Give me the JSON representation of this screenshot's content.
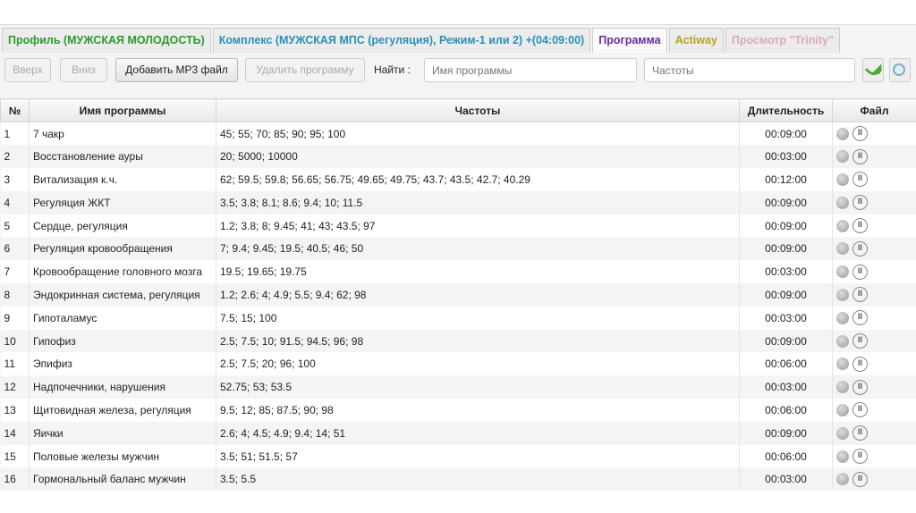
{
  "tabs": [
    {
      "label": "Профиль (МУЖСКАЯ МОЛОДОСТЬ)",
      "color": "#2e9a2e"
    },
    {
      "label": "Комплекс (МУЖСКАЯ МПС (регуляция), Режим-1 или 2) +(04:09:00)",
      "color": "#2a8fb8"
    },
    {
      "label": "Программа",
      "color": "#6a2aa0",
      "active": true
    },
    {
      "label": "Actiway",
      "color": "#b8a020"
    },
    {
      "label": "Просмотр  \"Trinity\"",
      "color": "#e0a8b0"
    }
  ],
  "toolbar": {
    "up": "Вверх",
    "down": "Вниз",
    "add_mp3": "Добавить MP3 файл",
    "delete": "Удалить программу",
    "find_label": "Найти  :",
    "name_placeholder": "Имя программы",
    "freq_placeholder": "Частоты",
    "refresh_icon": "green-arrow-icon",
    "search_icon": "magnifier-icon"
  },
  "table": {
    "headers": {
      "num": "№",
      "name": "Имя программы",
      "freq": "Частоты",
      "duration": "Длительность",
      "file": "Файл"
    },
    "rows": [
      [
        "1",
        "7 чакр",
        "45;  55;  70;  85;  90;  95;  100",
        "00:09:00"
      ],
      [
        "2",
        "Восстановление ауры",
        "20;  5000;  10000",
        "00:03:00"
      ],
      [
        "3",
        "Витализация к.ч.",
        "62;  59.5;  59.8;  56.65;  56.75;  49.65;  49.75;  43.7;  43.5;  42.7;  40.29",
        "00:12:00"
      ],
      [
        "4",
        "Регуляция ЖКТ",
        "3.5;  3.8;  8.1;  8.6;  9.4;  10;  11.5",
        "00:09:00"
      ],
      [
        "5",
        "Сердце, регуляция",
        "1.2;  3.8;  8;  9.45;  41;  43;  43.5;  97",
        "00:09:00"
      ],
      [
        "6",
        "Регуляция кровообращения",
        "7;  9.4;  9.45;  19.5;  40.5;  46;  50",
        "00:09:00"
      ],
      [
        "7",
        "Кровообращение головного мозга",
        "19.5;  19.65;  19.75",
        "00:03:00"
      ],
      [
        "8",
        "Эндокринная система, регуляция",
        "1.2;  2.6;  4;  4.9;  5.5;  9.4;  62;  98",
        "00:09:00"
      ],
      [
        "9",
        "Гипоталамус",
        "7.5;  15;  100",
        "00:03:00"
      ],
      [
        "10",
        "Гипофиз",
        "2.5;  7.5;  10;  91.5;  94.5;  96;  98",
        "00:09:00"
      ],
      [
        "11",
        "Эпифиз",
        "2.5;  7.5;  20;  96;  100",
        "00:06:00"
      ],
      [
        "12",
        "Надпочечники, нарушения",
        "52.75;  53;  53.5",
        "00:03:00"
      ],
      [
        "13",
        "Щитовидная железа, регуляция",
        "9.5;  12;  85;  87.5;  90;  98",
        "00:06:00"
      ],
      [
        "14",
        "Яички",
        "2.6;  4;  4.5;  4.9;  9.4;  14;  51",
        "00:09:00"
      ],
      [
        "15",
        "Половые железы мужчин",
        "3.5;  51;  51.5;  57",
        "00:06:00"
      ],
      [
        "16",
        "Гормональный баланс мужчин",
        "3.5;  5.5",
        "00:03:00"
      ]
    ]
  }
}
